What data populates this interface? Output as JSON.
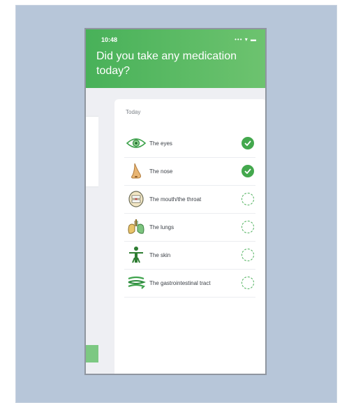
{
  "status": {
    "time": "10:48",
    "icons": "••• ▾ ▬"
  },
  "title": "Did you take any medication today?",
  "section_label": "Today",
  "items": [
    {
      "label": "The eyes",
      "icon": "eye-icon",
      "checked": true
    },
    {
      "label": "The nose",
      "icon": "nose-icon",
      "checked": true
    },
    {
      "label": "The mouth/the throat",
      "icon": "mouth-throat-icon",
      "checked": false
    },
    {
      "label": "The lungs",
      "icon": "lungs-icon",
      "checked": false
    },
    {
      "label": "The skin",
      "icon": "skin-icon",
      "checked": false
    },
    {
      "label": "The gastrointestinal tract",
      "icon": "gastrointestinal-icon",
      "checked": false
    }
  ],
  "colors": {
    "accent": "#43a84d",
    "header_start": "#48b159",
    "header_end": "#6dc36f",
    "background": "#b7c6d9"
  }
}
